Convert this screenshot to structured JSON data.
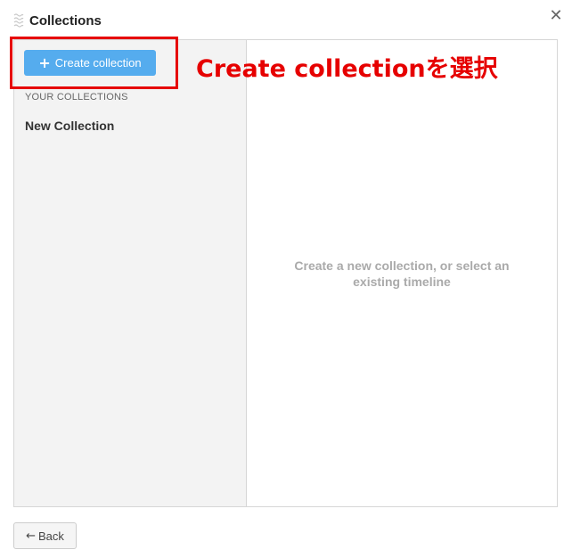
{
  "dialog": {
    "title": "Collections",
    "close_label": "✕"
  },
  "sidebar": {
    "create_button_label": "Create collection",
    "section_label": "YOUR COLLECTIONS",
    "items": [
      {
        "label": "New Collection"
      }
    ]
  },
  "content": {
    "empty_message": "Create a new collection, or select an existing timeline"
  },
  "footer": {
    "back_label": "Back"
  },
  "annotation": {
    "text": "Create collectionを選択",
    "color": "#e60000"
  },
  "colors": {
    "accent": "#55acee",
    "sidebar_bg": "#f3f3f3",
    "border": "#d6d6d6"
  },
  "icons": {
    "drag": "drag-handle-icon",
    "close": "close-icon",
    "plus": "plus-icon",
    "back": "left-arrow-icon"
  }
}
